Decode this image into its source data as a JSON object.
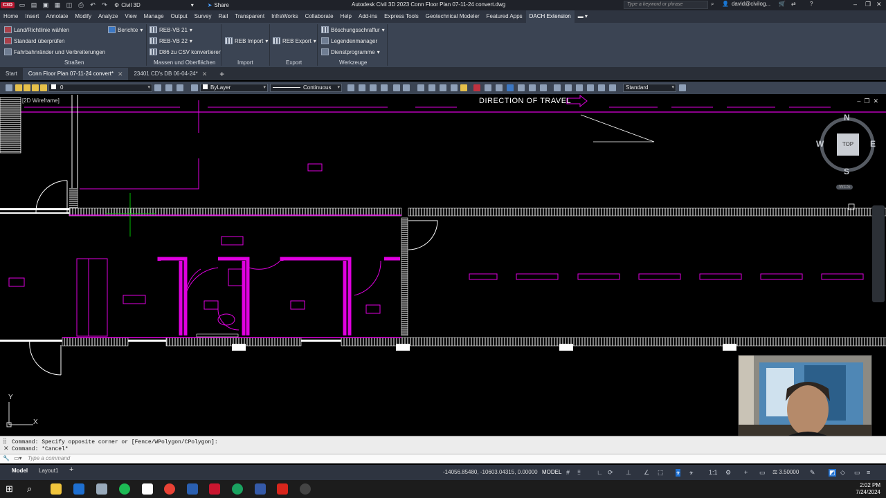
{
  "titlebar": {
    "app_badge": "C3D",
    "workspace": "Civil 3D",
    "share_label": "Share",
    "title": "Autodesk Civil 3D 2023    Conn Floor Plan 07-11-24 convert.dwg",
    "search_placeholder": "Type a keyword or phrase",
    "user": "david@civilog..."
  },
  "menu": {
    "items": [
      "Home",
      "Insert",
      "Annotate",
      "Modify",
      "Analyze",
      "View",
      "Manage",
      "Output",
      "Survey",
      "Rail",
      "Transparent",
      "InfraWorks",
      "Collaborate",
      "Help",
      "Add-ins",
      "Express Tools",
      "Geotechnical Modeler",
      "Featured Apps",
      "DACH Extension"
    ],
    "active_index": 18
  },
  "ribbon": {
    "strassen": {
      "items": [
        "Land/Richtlinie wählen",
        "Standard überprüfen",
        "Fahrbahnränder und Verbreiterungen"
      ],
      "berichte": "Berichte",
      "label": "Straßen"
    },
    "massen": {
      "items": [
        "REB-VB 21",
        "REB-VB 22",
        "D86 zu CSV konvertieren"
      ],
      "label": "Massen und Oberflächen"
    },
    "import": {
      "button": "REB Import",
      "label": "Import"
    },
    "export": {
      "button": "REB Export",
      "label": "Export"
    },
    "werkzeuge": {
      "items": [
        "Böschungsschraffur",
        "Legendenmanager",
        "Dienstprogramme"
      ],
      "label": "Werkzeuge"
    }
  },
  "filetabs": {
    "start": "Start",
    "tabs": [
      "Conn Floor Plan 07-11-24 convert*",
      "23401 CD's DB 06-04-24*"
    ],
    "active_index": 0
  },
  "properties": {
    "layer": "0",
    "color": "ByLayer",
    "linetype": "Continuous",
    "style": "Standard"
  },
  "viewport": {
    "view_label": "[2D Wireframe]",
    "annotation": "DIRECTION OF TRAVEL",
    "viewcube": {
      "n": "N",
      "s": "S",
      "e": "E",
      "w": "W",
      "top": "TOP"
    },
    "wcs": "WCS",
    "ucs_x": "X",
    "ucs_y": "Y"
  },
  "command": {
    "history": [
      "Command: Specify opposite corner or [Fence/WPolygon/CPolygon]:",
      "Command: *Cancel*"
    ],
    "placeholder": "Type a command"
  },
  "status": {
    "layouts": [
      "Model",
      "Layout1"
    ],
    "coords": "-14056.85480, -10603.04315, 0.00000",
    "model": "MODEL",
    "scale": "1:1",
    "value": "3.50000"
  },
  "clock": {
    "time": "2:02 PM",
    "date": "7/24/2024"
  },
  "colors": {
    "magenta": "#e000e0",
    "ribbon": "#3b4453",
    "wall": "#ffffff"
  }
}
